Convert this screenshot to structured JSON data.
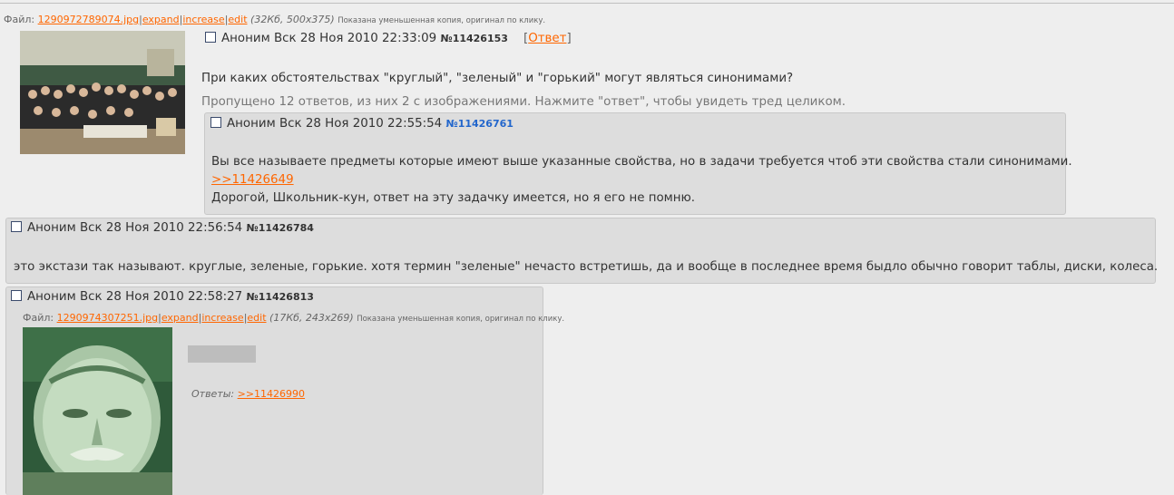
{
  "op": {
    "file_label": "Файл:",
    "file_name": "1290972789074.jpg",
    "expand": "expand",
    "increase": "increase",
    "edit": "edit",
    "meta": "(32Кб, 500x375)",
    "notice": "Показана уменьшенная копия, оригинал по клику.",
    "author": "Аноним",
    "date": "Вск 28 Ноя 2010 22:33:09",
    "number": "№11426153",
    "reply_open": "[",
    "reply_link": "Ответ",
    "reply_close": "]",
    "text": "При каких обстоятельствах \"круглый\", \"зеленый\" и \"горький\" могут являться синонимами?",
    "omitted": "Пропущено 12 ответов, из них 2 с изображениями. Нажмите \"ответ\", чтобы увидеть тред целиком."
  },
  "reply1": {
    "author": "Аноним",
    "date": "Вск 28 Ноя 2010 22:55:54",
    "number": "№11426761",
    "line1": "Вы все называете предметы которые имеют выше указанные свойства, но в задачи требуется чтоб эти свойства стали синонимами.",
    "link": ">>11426649",
    "line2": "Дорогой, Школьник-кун, ответ на эту задачку имеется, но я его не помню."
  },
  "reply2": {
    "author": "Аноним",
    "date": "Вск 28 Ноя 2010 22:56:54",
    "number": "№11426784",
    "text": "это экстази так называют. круглые, зеленые, горькие. хотя термин \"зеленые\" нечасто встретишь, да и вообще в последнее время быдло обычно говорит таблы, диски, колеса."
  },
  "reply3": {
    "author": "Аноним",
    "date": "Вск 28 Ноя 2010 22:58:27",
    "number": "№11426813",
    "file_label": "Файл:",
    "file_name": "1290974307251.jpg",
    "expand": "expand",
    "increase": "increase",
    "edit": "edit",
    "meta": "(17Кб, 243x269)",
    "notice": "Показана уменьшенная копия, оригинал по клику.",
    "answers_label": "Ответы:",
    "answers_link": ">>11426990"
  },
  "colors": {
    "link": "#ff6600",
    "reply_bg": "#dddddd",
    "page_bg": "#eeeeee",
    "post_number_blue": "#2266cc"
  }
}
